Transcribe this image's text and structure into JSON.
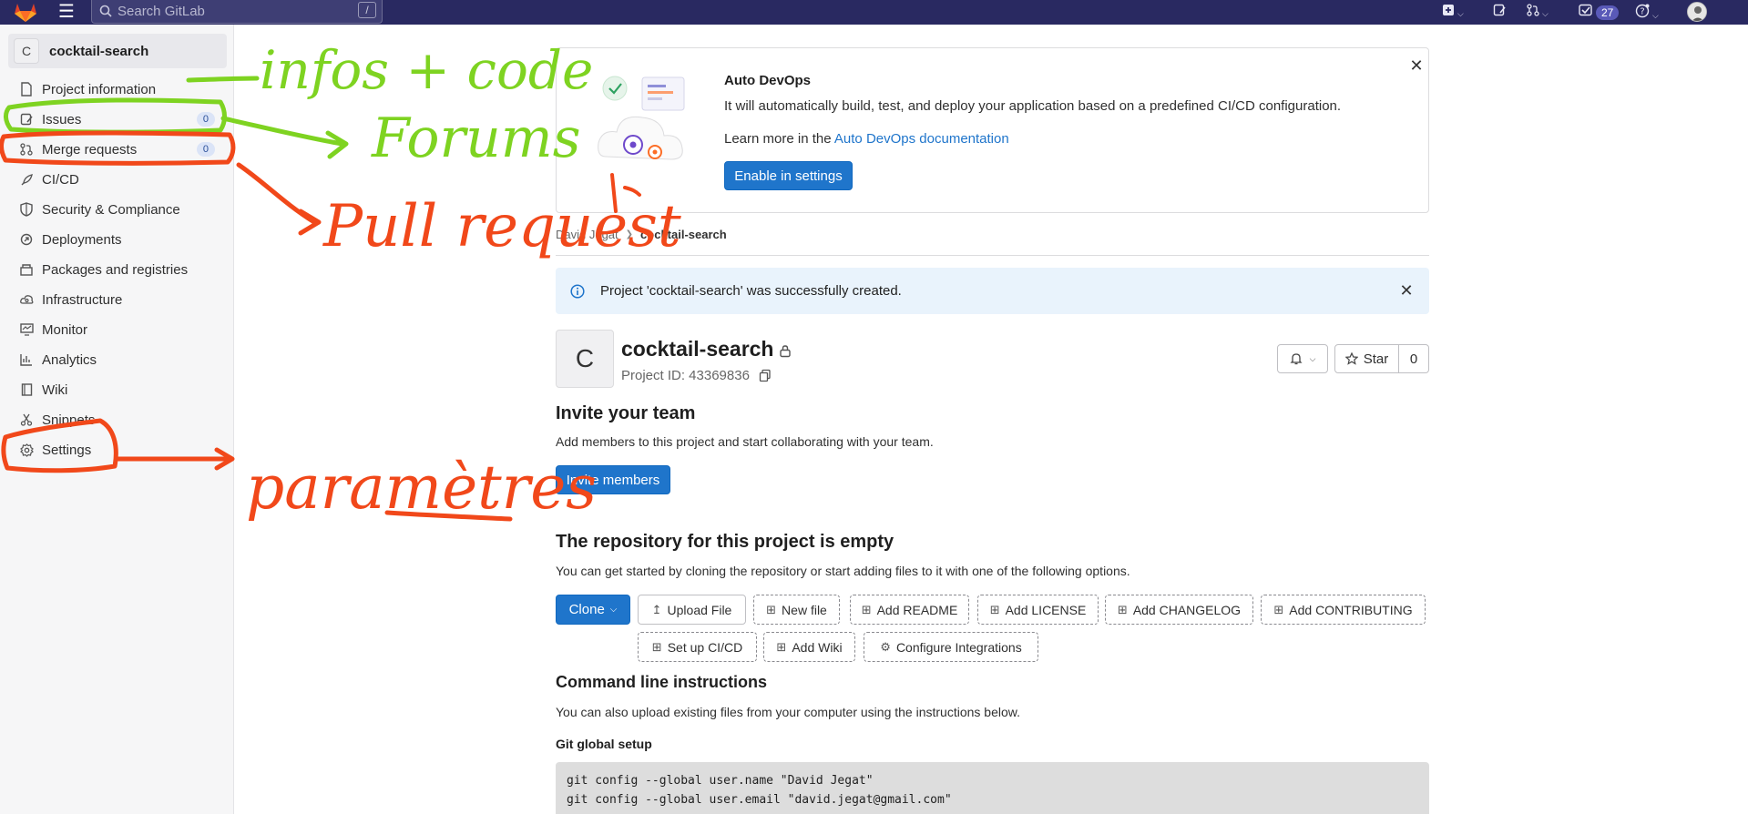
{
  "topbar": {
    "search_placeholder": "Search GitLab",
    "search_shortcut": "/",
    "todo_count": "27"
  },
  "sidebar": {
    "project_initial": "C",
    "project_name": "cocktail-search",
    "items": [
      {
        "label": "Project information",
        "icon": "project-icon"
      },
      {
        "label": "Issues",
        "icon": "issues-icon",
        "badge": "0"
      },
      {
        "label": "Merge requests",
        "icon": "merge-request-icon",
        "badge": "0"
      },
      {
        "label": "CI/CD",
        "icon": "rocket-icon"
      },
      {
        "label": "Security & Compliance",
        "icon": "shield-icon"
      },
      {
        "label": "Deployments",
        "icon": "deployments-icon"
      },
      {
        "label": "Packages and registries",
        "icon": "package-icon"
      },
      {
        "label": "Infrastructure",
        "icon": "cloud-gear-icon"
      },
      {
        "label": "Monitor",
        "icon": "monitor-icon"
      },
      {
        "label": "Analytics",
        "icon": "chart-icon"
      },
      {
        "label": "Wiki",
        "icon": "book-icon"
      },
      {
        "label": "Snippets",
        "icon": "snippet-icon"
      },
      {
        "label": "Settings",
        "icon": "gear-icon"
      }
    ]
  },
  "devops": {
    "title": "Auto DevOps",
    "description": "It will automatically build, test, and deploy your application based on a predefined CI/CD configuration.",
    "learn_prefix": "Learn more in the ",
    "learn_link": "Auto DevOps documentation",
    "button": "Enable in settings"
  },
  "breadcrumb": {
    "parent": "David Jegat",
    "current": "cocktail-search"
  },
  "alert": {
    "message": "Project 'cocktail-search' was successfully created."
  },
  "project": {
    "initial": "C",
    "name": "cocktail-search",
    "id_label": "Project ID: 43369836",
    "star_label": "Star",
    "star_count": "0"
  },
  "invite": {
    "heading": "Invite your team",
    "text": "Add members to this project and start collaborating with your team.",
    "button": "Invite members"
  },
  "empty_repo": {
    "heading": "The repository for this project is empty",
    "text": "You can get started by cloning the repository or start adding files to it with one of the following options.",
    "clone": "Clone",
    "upload": "Upload File",
    "new_file": "New file",
    "add_readme": "Add README",
    "add_license": "Add LICENSE",
    "add_changelog": "Add CHANGELOG",
    "add_contributing": "Add CONTRIBUTING",
    "setup_cicd": "Set up CI/CD",
    "add_wiki": "Add Wiki",
    "configure_integrations": "Configure Integrations"
  },
  "cli": {
    "heading": "Command line instructions",
    "text": "You can also upload existing files from your computer using the instructions below.",
    "git_setup": "Git global setup",
    "line1": "git config --global user.name \"David Jegat\"",
    "line2": "git config --global user.email \"david.jegat@gmail.com\""
  },
  "annotations": {
    "infos": "infos + code",
    "forums": "Forums",
    "pull": "Pull request",
    "params": "paramètres",
    "green": "#7ed321",
    "red": "#f1481a"
  }
}
